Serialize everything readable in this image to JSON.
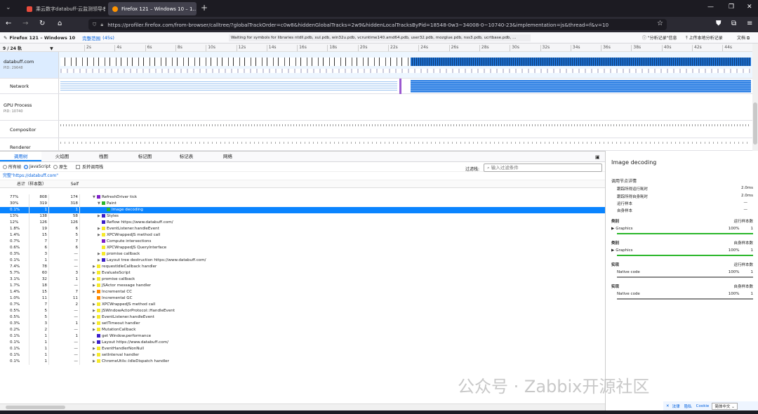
{
  "browser": {
    "tabs": [
      {
        "label": "乘云数字databuff-云监测领导者",
        "active": false,
        "color": "#e84b3c"
      },
      {
        "label": "Firefox 121 – Windows 10 – 1…",
        "active": true,
        "color": "#ff9400"
      }
    ],
    "new_tab": "+",
    "url": "https://profiler.firefox.com/from-browser/calltree/?globalTrackOrder=c0w8&hiddenGlobalTracks=2w9&hiddenLocalTracksByPid=18548-0w3~34008-0~10740-23&implementation=js&thread=f&v=10",
    "url_domain": "profiler.firefox.com"
  },
  "profiler": {
    "title": "Firefox 121 – Windows 10",
    "full_range": "完整范围",
    "duration": "(45s)",
    "status": "Waiting for symbols for libraries ntdll.pdb, xul.pdb, win32u.pdb, vcruntime140.amd64.pdb, user32.pdb, mozglue.pdb, nss3.pdb, ucrtbase.pdb, …",
    "info_button": "\"分析记录\"信息",
    "upload_button": "上传本地分析记录",
    "docs_button": "文档",
    "track_count": "9 / 24 轨",
    "ticks": [
      "2s",
      "4s",
      "6s",
      "8s",
      "10s",
      "12s",
      "14s",
      "16s",
      "18s",
      "20s",
      "22s",
      "24s",
      "26s",
      "28s",
      "30s",
      "32s",
      "34s",
      "36s",
      "38s",
      "40s",
      "42s",
      "44s"
    ]
  },
  "tracks": [
    {
      "name": "databuff.com",
      "pid": "PID: 29648"
    },
    {
      "name": "Network",
      "pid": ""
    },
    {
      "name": "GPU Process",
      "pid": "PID: 10740"
    },
    {
      "name": "Compositor",
      "pid": ""
    },
    {
      "name": "Renderer",
      "pid": ""
    }
  ],
  "panel": {
    "tabs": [
      "调用树",
      "火焰图",
      "栈图",
      "标记图",
      "标记表",
      "网络"
    ],
    "opt_all": "所有帧",
    "opt_js": "JavaScript",
    "opt_native": "原生",
    "opt_invert": "反转调用栈",
    "filter_label": "过滤栈:",
    "filter_placeholder": "输入过滤条件",
    "breadcrumb": "完整\"https://databuff.com\"",
    "col_total": "总计（样本数）",
    "col_self": "Self"
  },
  "rows": [
    {
      "pct": "77%",
      "total": "808",
      "self": "174",
      "name": "RefreshDriver tick",
      "depth": 0,
      "tw": "▼",
      "color": "#7e1fc9"
    },
    {
      "pct": "30%",
      "total": "319",
      "self": "318",
      "name": "Paint",
      "depth": 1,
      "tw": "▼",
      "color": "#2ab62a"
    },
    {
      "pct": "0.1%",
      "total": "1",
      "self": "1",
      "name": "Image decoding",
      "depth": 2,
      "tw": "",
      "color": "#2ab62a",
      "sel": true
    },
    {
      "pct": "13%",
      "total": "138",
      "self": "58",
      "name": "Styles",
      "depth": 1,
      "tw": "▶",
      "color": "#3a1fc9"
    },
    {
      "pct": "12%",
      "total": "126",
      "self": "126",
      "name": "Reflow https://www.databuff.com/",
      "depth": 1,
      "tw": "",
      "color": "#3a1fc9"
    },
    {
      "pct": "1.8%",
      "total": "19",
      "self": "6",
      "name": "EventListener.handleEvent",
      "depth": 1,
      "tw": "▶",
      "color": "#f5e92a"
    },
    {
      "pct": "1.4%",
      "total": "15",
      "self": "5",
      "name": "XPCWrappedJS method call",
      "depth": 1,
      "tw": "▶",
      "color": "#f5e92a"
    },
    {
      "pct": "0.7%",
      "total": "7",
      "self": "7",
      "name": "Compute intersections",
      "depth": 1,
      "tw": "",
      "color": "#7e1fc9"
    },
    {
      "pct": "0.6%",
      "total": "6",
      "self": "6",
      "name": "XPCWrappedJS QueryInterface",
      "depth": 1,
      "tw": "",
      "color": "#f5e92a"
    },
    {
      "pct": "0.3%",
      "total": "3",
      "self": "—",
      "name": "promise callback",
      "depth": 1,
      "tw": "▶",
      "color": "#f5e92a"
    },
    {
      "pct": "0.1%",
      "total": "1",
      "self": "—",
      "name": "Layout tree destruction https://www.databuff.com/",
      "depth": 1,
      "tw": "▶",
      "color": "#3a1fc9"
    },
    {
      "pct": "7.4%",
      "total": "78",
      "self": "—",
      "name": "requestIdleCallback handler",
      "depth": 0,
      "tw": "▶",
      "color": "#f5e92a"
    },
    {
      "pct": "5.7%",
      "total": "60",
      "self": "3",
      "name": "EvaluateScript",
      "depth": 0,
      "tw": "▶",
      "color": "#f5e92a"
    },
    {
      "pct": "3.1%",
      "total": "32",
      "self": "1",
      "name": "promise callback",
      "depth": 0,
      "tw": "▶",
      "color": "#f5e92a"
    },
    {
      "pct": "1.7%",
      "total": "18",
      "self": "—",
      "name": "JSActor message handler",
      "depth": 0,
      "tw": "▶",
      "color": "#f5e92a"
    },
    {
      "pct": "1.4%",
      "total": "15",
      "self": "7",
      "name": "Incremental CC",
      "depth": 0,
      "tw": "▶",
      "color": "#ff8a00"
    },
    {
      "pct": "1.0%",
      "total": "11",
      "self": "11",
      "name": "Incremental GC",
      "depth": 0,
      "tw": "",
      "color": "#ff8a00"
    },
    {
      "pct": "0.7%",
      "total": "7",
      "self": "2",
      "name": "XPCWrappedJS method call",
      "depth": 0,
      "tw": "▶",
      "color": "#f5e92a"
    },
    {
      "pct": "0.5%",
      "total": "5",
      "self": "—",
      "name": "JSWindowActorProtocol::HandleEvent",
      "depth": 0,
      "tw": "▶",
      "color": "#f5e92a"
    },
    {
      "pct": "0.5%",
      "total": "5",
      "self": "—",
      "name": "EventListener.handleEvent",
      "depth": 0,
      "tw": "▶",
      "color": "#f5e92a"
    },
    {
      "pct": "0.3%",
      "total": "3",
      "self": "1",
      "name": "setTimeout handler",
      "depth": 0,
      "tw": "▶",
      "color": "#f5e92a"
    },
    {
      "pct": "0.2%",
      "total": "2",
      "self": "—",
      "name": "MutationCallback",
      "depth": 0,
      "tw": "▶",
      "color": "#f5e92a"
    },
    {
      "pct": "0.1%",
      "total": "1",
      "self": "1",
      "name": "get Window.performance",
      "depth": 0,
      "tw": "",
      "color": "#3a1fc9"
    },
    {
      "pct": "0.1%",
      "total": "1",
      "self": "—",
      "name": "Layout https://www.databuff.com/",
      "depth": 0,
      "tw": "▶",
      "color": "#3a1fc9"
    },
    {
      "pct": "0.1%",
      "total": "1",
      "self": "—",
      "name": "EventHandlerNonNull",
      "depth": 0,
      "tw": "▶",
      "color": "#f5e92a"
    },
    {
      "pct": "0.1%",
      "total": "1",
      "self": "—",
      "name": "setInterval handler",
      "depth": 0,
      "tw": "▶",
      "color": "#f5e92a"
    },
    {
      "pct": "0.1%",
      "total": "1",
      "self": "—",
      "name": "ChromeUtils::IdleDispatch handler",
      "depth": 0,
      "tw": "▶",
      "color": "#f5e92a"
    }
  ],
  "sidebar": {
    "title": "Image decoding",
    "section1": "调用节点详情",
    "run_time_label": "跟踪所得运行耗时",
    "run_time": "2.0ms",
    "self_time_label": "跟踪所得自身耗时",
    "self_time": "2.0ms",
    "run_samples_label": "运行样本",
    "run_samples": "—",
    "self_samples_label": "自身样本",
    "self_samples": "—",
    "cat1": "类别",
    "cat1_right": "运行样本数",
    "cat1_item": "Graphics",
    "cat1_pct": "100%",
    "cat1_n": "1",
    "cat2": "类别",
    "cat2_right": "自身样本数",
    "cat2_item": "Graphics",
    "cat2_pct": "100%",
    "cat2_n": "1",
    "impl1": "实现",
    "impl1_right": "运行样本数",
    "impl1_item": "Native code",
    "impl1_pct": "100%",
    "impl1_n": "1",
    "impl2": "实现",
    "impl2_right": "自身样本数",
    "impl2_item": "Native code",
    "impl2_pct": "100%",
    "impl2_n": "1"
  },
  "consent": {
    "a": "法律",
    "b": "隐私",
    "c": "Cookie",
    "lang": "简体中文"
  },
  "watermark": "公众号 · Zabbix开源社区"
}
